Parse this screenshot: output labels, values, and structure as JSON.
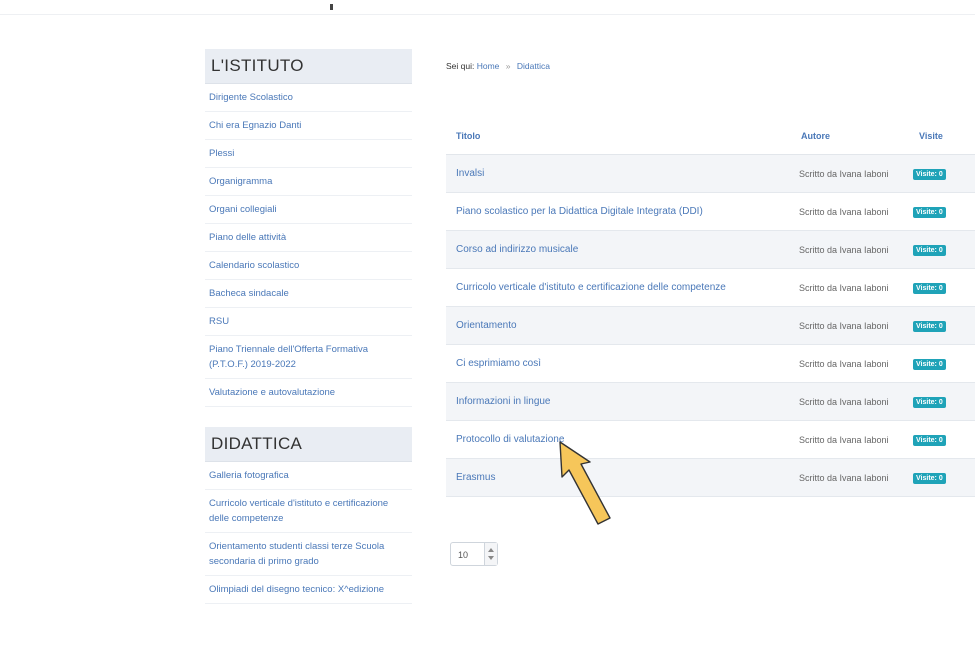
{
  "sidebar": {
    "istituto": {
      "title": "L'ISTITUTO",
      "items": [
        "Dirigente Scolastico",
        "Chi era Egnazio Danti",
        "Plessi",
        "Organigramma",
        "Organi collegiali",
        "Piano delle attività",
        "Calendario scolastico",
        "Bacheca sindacale",
        "RSU",
        "Piano Triennale dell'Offerta Formativa (P.T.O.F.) 2019-2022",
        "Valutazione e autovalutazione"
      ]
    },
    "didattica": {
      "title": "DIDATTICA",
      "items": [
        "Galleria fotografica",
        "Curricolo verticale d'istituto e certificazione delle competenze",
        "Orientamento studenti classi terze Scuola secondaria di primo grado",
        "Olimpiadi del disegno tecnico: X^edizione"
      ]
    }
  },
  "breadcrumb": {
    "label": "Sei qui:",
    "home": "Home",
    "separator": "»",
    "current": "Didattica"
  },
  "table": {
    "headers": {
      "title": "Titolo",
      "author": "Autore",
      "views": "Visite"
    },
    "rows": [
      {
        "title": "Invalsi",
        "author": "Scritto da Ivana Iaboni",
        "views": "Visite: 0"
      },
      {
        "title": "Piano scolastico per la Didattica Digitale Integrata (DDI)",
        "author": "Scritto da Ivana Iaboni",
        "views": "Visite: 0"
      },
      {
        "title": "Corso ad indirizzo musicale",
        "author": "Scritto da Ivana Iaboni",
        "views": "Visite: 0"
      },
      {
        "title": "Curricolo verticale d'istituto e certificazione delle competenze",
        "author": "Scritto da Ivana Iaboni",
        "views": "Visite: 0"
      },
      {
        "title": "Orientamento",
        "author": "Scritto da Ivana Iaboni",
        "views": "Visite: 0"
      },
      {
        "title": "Ci esprimiamo così",
        "author": "Scritto da Ivana Iaboni",
        "views": "Visite: 0"
      },
      {
        "title": "Informazioni in lingue",
        "author": "Scritto da Ivana Iaboni",
        "views": "Visite: 0"
      },
      {
        "title": "Protocollo di valutazione",
        "author": "Scritto da Ivana Iaboni",
        "views": "Visite: 0"
      },
      {
        "title": "Erasmus",
        "author": "Scritto da Ivana Iaboni",
        "views": "Visite: 0"
      }
    ]
  },
  "pagination": {
    "limit_value": "10"
  },
  "colors": {
    "link": "#4a78b8",
    "badge": "#1fa3b8",
    "section_bg": "#e9edf3",
    "arrow": "#f6c65a"
  },
  "icons": {
    "annotation": "arrow-icon"
  }
}
